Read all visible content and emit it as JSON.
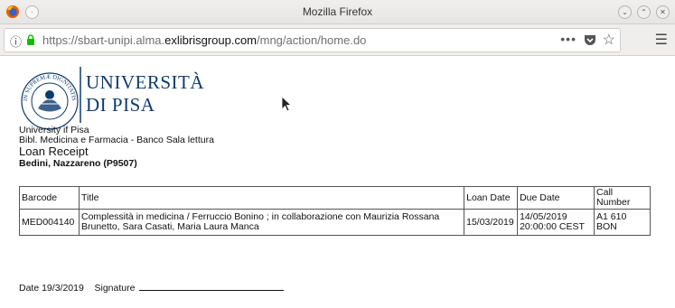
{
  "window": {
    "title": "Mozilla Firefox"
  },
  "browser": {
    "url_prefix": "https://sbart-unipi.alma.",
    "url_domain": "exlibrisgroup.com",
    "url_suffix": "/mng/action/home.do",
    "page_actions": "•••"
  },
  "receipt": {
    "logo_line1": "UNIVERSITÀ",
    "logo_line2": "DI PISA",
    "seal_text": "IN SUPREMÆ DIGNITATIS · 1343",
    "institution": "University if Pisa",
    "library": "Bibl. Medicina e Farmacia - Banco Sala lettura",
    "heading": "Loan Receipt",
    "patron": "Bedini, Nazzareno (P9507)",
    "columns": [
      "Barcode",
      "Title",
      "Loan Date",
      "Due Date",
      "Call Number"
    ],
    "rows": [
      {
        "barcode": "MED004140",
        "title": "Complessità in medicina / Ferruccio Bonino ; in collaborazione con Maurizia Rossana Brunetto, Sara Casati, Maria Laura Manca",
        "loan_date": "15/03/2019",
        "due_date": "14/05/2019 20:00:00 CEST",
        "call_number": "A1 610 BON"
      }
    ],
    "date_label": "Date 19/3/2019",
    "signature_label": "Signature"
  },
  "colors": {
    "brand_blue": "#0d3b6e",
    "lock_green": "#12bc00"
  }
}
